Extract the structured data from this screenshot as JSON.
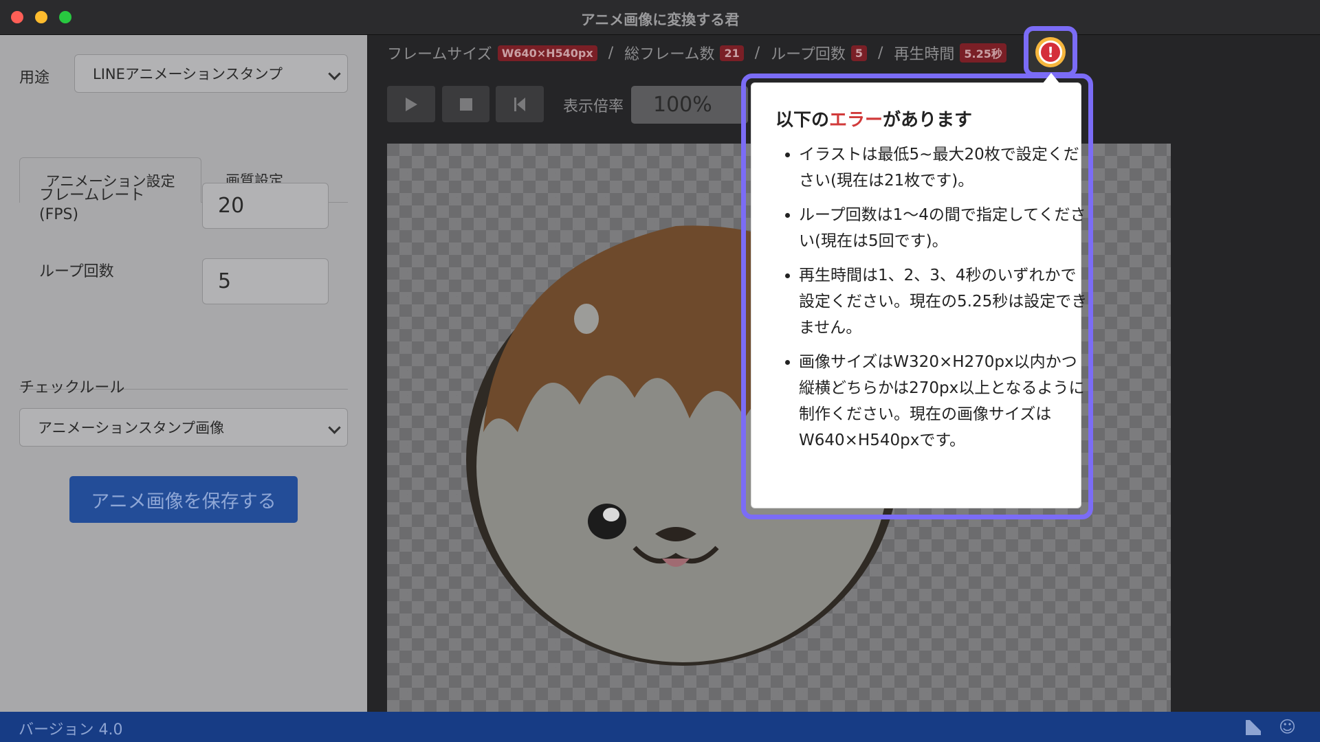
{
  "window": {
    "title": "アニメ画像に変換する君"
  },
  "left_panel": {
    "purpose_label": "用途",
    "purpose_value": "LINEアニメーションスタンプ",
    "tabs": [
      {
        "label": "アニメーション設定",
        "active": true
      },
      {
        "label": "画質設定",
        "active": false
      }
    ],
    "frame_rate_label_line1": "フレームレート",
    "frame_rate_label_line2": "(FPS)",
    "frame_rate_value": "20",
    "loop_label": "ループ回数",
    "loop_value": "5",
    "check_rule_label": "チェックルール",
    "check_rule_value": "アニメーションスタンプ画像",
    "save_button": "アニメ画像を保存する"
  },
  "info_bar": {
    "frame_size_label": "フレームサイズ",
    "frame_size_value": "W640×H540px",
    "total_frames_label": "総フレーム数",
    "total_frames_value": "21",
    "loop_label": "ループ回数",
    "loop_value": "5",
    "duration_label": "再生時間",
    "duration_value": "5.25秒",
    "separator": "/"
  },
  "controls": {
    "zoom_label": "表示倍率",
    "zoom_value": "100%",
    "play_icon": "play-icon",
    "stop_icon": "stop-icon",
    "rewind_icon": "skip-to-start-icon"
  },
  "error_popover": {
    "title_prefix": "以下の",
    "title_highlight": "エラー",
    "title_suffix": "があります",
    "items": [
      "イラストは最低5~最大20枚で設定ください(現在は21枚です)。",
      "ループ回数は1〜4の間で指定してください(現在は5回です)。",
      "再生時間は1、2、3、4秒のいずれかで設定ください。現在の5.25秒は設定できません。",
      "画像サイズはW320×H270px以内かつ縦横どちらかは270px以上となるように制作ください。現在の画像サイズはW640×H540pxです。"
    ]
  },
  "status_bar": {
    "version": "バージョン 4.0"
  },
  "colors": {
    "accent_ring": "#7b6cf6",
    "error_red": "#d13a3a",
    "status_bar": "#173c85",
    "save_button": "#234d98"
  }
}
